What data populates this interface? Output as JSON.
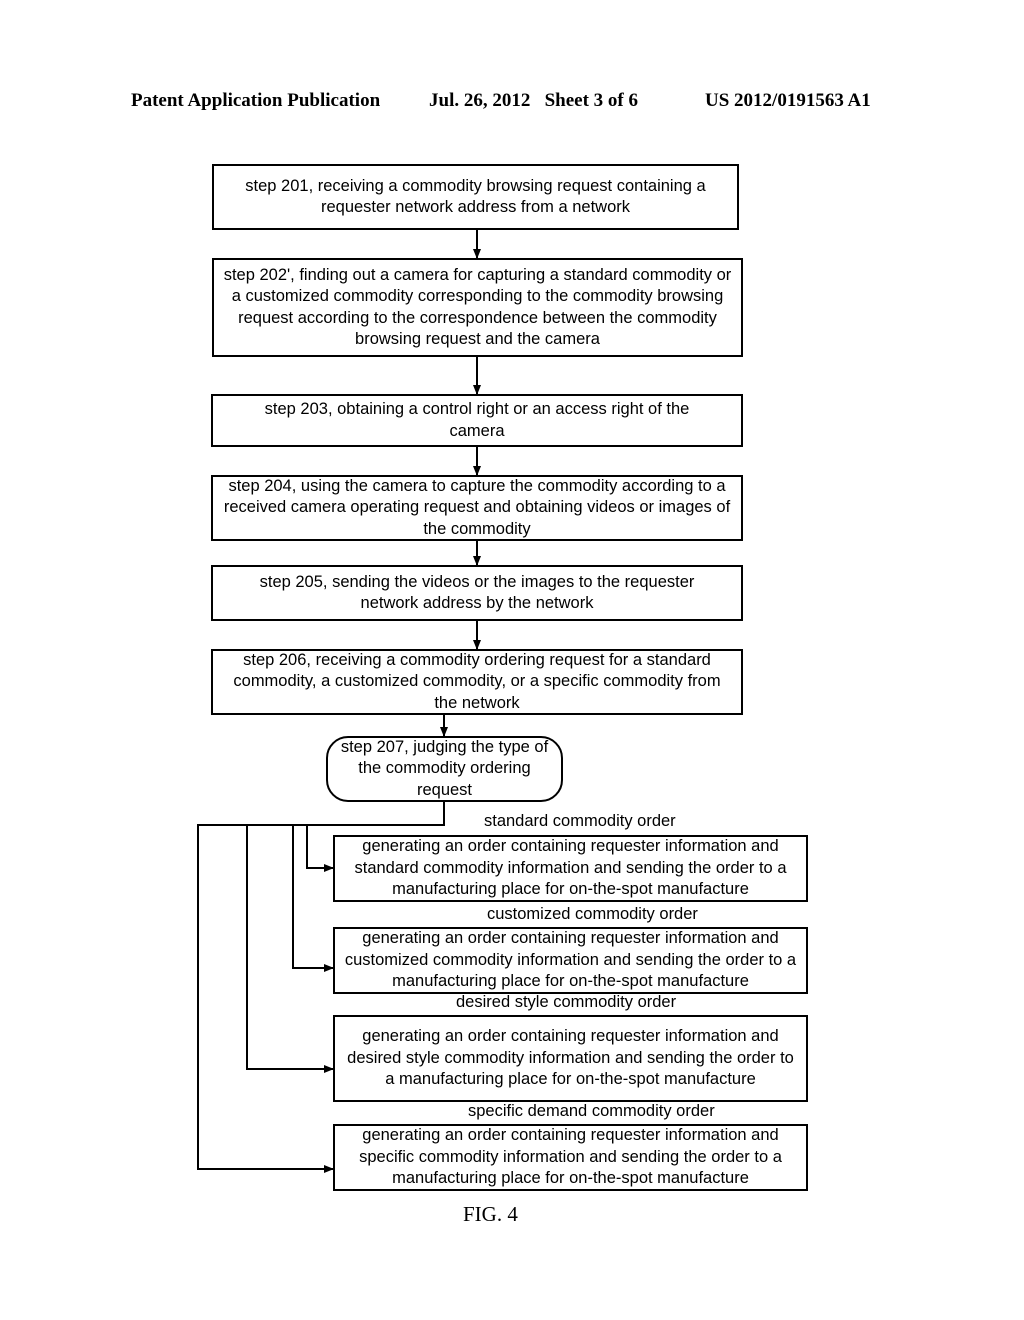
{
  "header": {
    "left": "Patent Application Publication",
    "date_sheet": "Jul. 26, 2012   Sheet 3 of 6",
    "number": "US 2012/0191563 A1"
  },
  "steps": [
    {
      "id": "step-201",
      "text": "step 201, receiving a commodity browsing request containing a requester network address from a network"
    },
    {
      "id": "step-202",
      "text": "step 202', finding out a camera for capturing a standard commodity or a customized commodity corresponding to the commodity browsing request according to the correspondence between the commodity browsing request and the camera"
    },
    {
      "id": "step-203",
      "text": "step 203, obtaining a control right or an access right of the camera"
    },
    {
      "id": "step-204",
      "text": "step 204, using the camera to capture the commodity according to a received camera operating request and obtaining videos or images of the commodity"
    },
    {
      "id": "step-205",
      "text": "step 205, sending the videos or the images to the requester network address by the network"
    },
    {
      "id": "step-206",
      "text": "step 206, receiving a commodity ordering request for a standard commodity, a customized commodity, or a specific commodity from the network"
    },
    {
      "id": "step-207",
      "text": "step 207, judging the type of the commodity ordering request"
    }
  ],
  "branches": [
    {
      "label": "standard commodity order",
      "text": "generating an order containing requester information and standard commodity information and sending the order to a manufacturing place for on-the-spot manufacture"
    },
    {
      "label": "customized commodity order",
      "text": "generating an order containing requester information and customized commodity information and sending the order to a manufacturing place for on-the-spot manufacture"
    },
    {
      "label": "desired style commodity order",
      "text": "generating an order containing requester information and desired style commodity information and sending the order to a manufacturing place for on-the-spot manufacture"
    },
    {
      "label": "specific demand commodity order",
      "text": "generating an order containing requester information and specific commodity information and sending the order to a manufacturing place for on-the-spot manufacture"
    }
  ],
  "caption": "FIG. 4"
}
